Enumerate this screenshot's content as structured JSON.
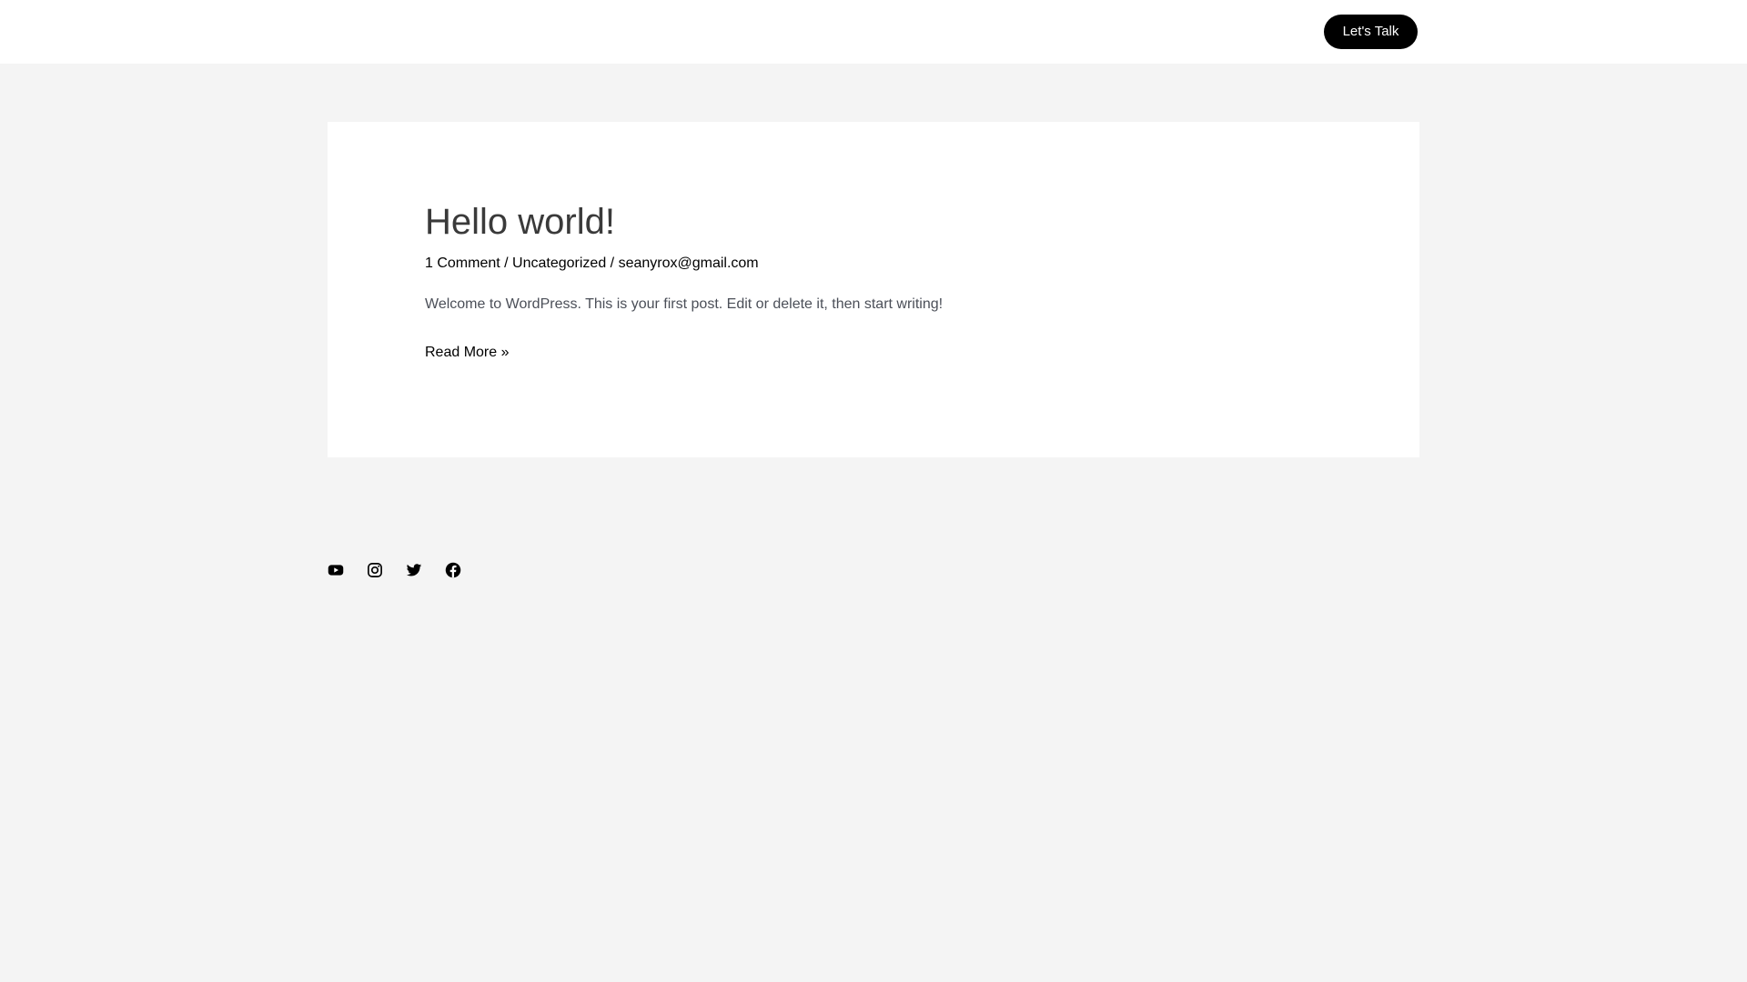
{
  "header": {
    "cta_label": "Let's Talk"
  },
  "post": {
    "title": "Hello world!",
    "meta": {
      "comments": "1 Comment",
      "separator": " / ",
      "category": "Uncategorized",
      "author": "seanyrox@gmail.com"
    },
    "excerpt": "Welcome to WordPress. This is your first post. Edit or delete it, then start writing!",
    "read_more": "Read More »"
  },
  "footer": {
    "social_icons": [
      "youtube-icon",
      "instagram-icon",
      "twitter-icon",
      "facebook-icon"
    ]
  },
  "colors": {
    "page_background": "#f4f4f4",
    "card_background": "#ffffff",
    "button_background": "#000000",
    "button_text": "#ffffff"
  }
}
